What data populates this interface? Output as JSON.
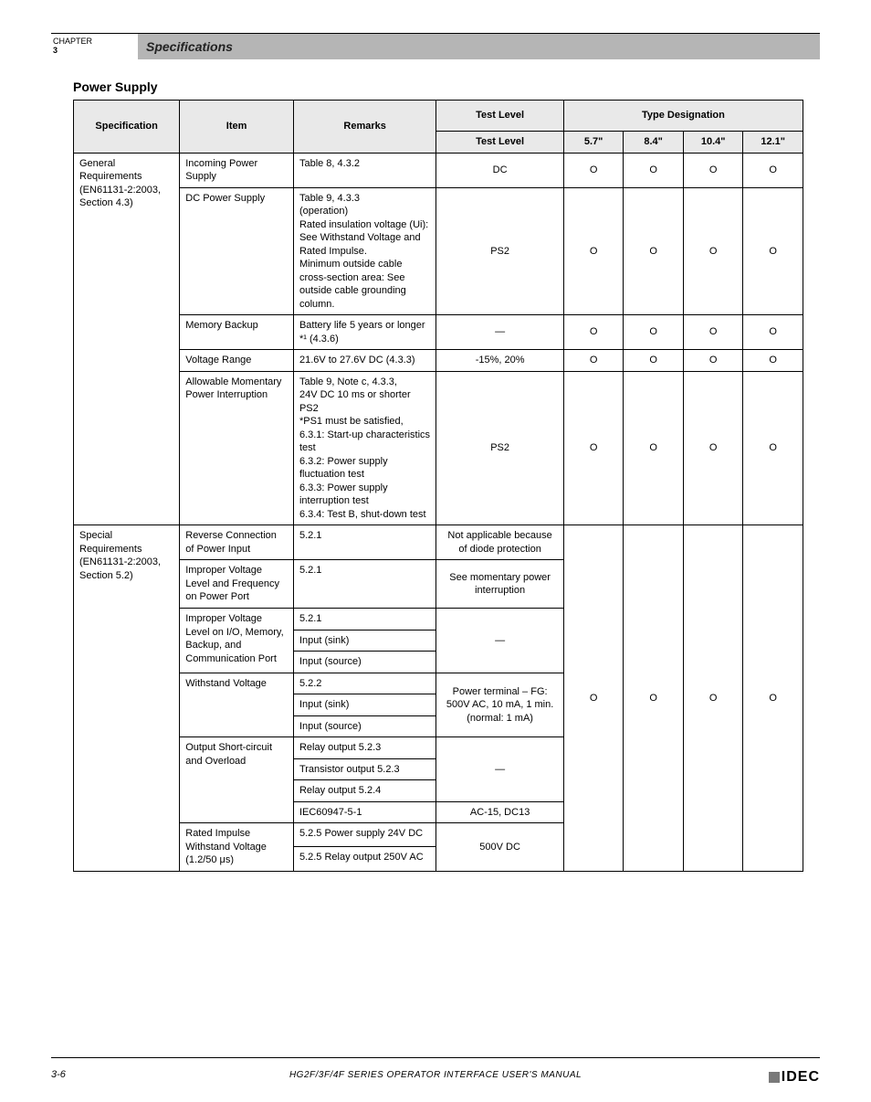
{
  "header": {
    "chapter_line1": "CHAPTER",
    "chapter_line2": "3",
    "title": "Specifications"
  },
  "section_title": "Power Supply",
  "table": {
    "headers": {
      "spec": "Specification",
      "item": "Item",
      "remarks": "Remarks",
      "test_level": "Test Level",
      "type_header": "Type Designation",
      "types": [
        "5.7\"",
        "8.4\"",
        "10.4\"",
        "12.1\""
      ]
    },
    "groups": [
      {
        "spec": "General Requirements\n(EN61131-2:2003,\nSection 4.3)",
        "rows": [
          {
            "item": "Incoming Power Supply",
            "remarks": "Table 8, 4.3.2",
            "test_level": "DC",
            "cells": [
              "O",
              "O",
              "O",
              "O"
            ]
          },
          {
            "item": "DC Power Supply",
            "remarks": "Table 9, 4.3.3\n(operation)\nRated insulation voltage (Ui): See Withstand Voltage and Rated Impulse.\nMinimum outside cable cross-section area: See outside cable grounding column.",
            "test_level": "PS2",
            "cells": [
              "O",
              "O",
              "O",
              "O"
            ]
          },
          {
            "item": "Memory Backup",
            "remarks": "Battery life 5 years or longer *¹ (4.3.6)",
            "test_level": "—",
            "cells": [
              "O",
              "O",
              "O",
              "O"
            ]
          },
          {
            "item": "Voltage Range",
            "remarks": "21.6V to 27.6V DC (4.3.3)",
            "test_level": "-15%, 20%",
            "cells": [
              "O",
              "O",
              "O",
              "O"
            ]
          },
          {
            "item": "Allowable Momentary Power Interruption",
            "remarks": "Table 9, Note c, 4.3.3,\n24V DC 10 ms or shorter PS2\n*PS1 must be satisfied,\n6.3.1: Start-up characteristics test\n6.3.2: Power supply fluctuation test\n6.3.3: Power supply interruption test\n6.3.4: Test B, shut-down test",
            "test_level": "PS2",
            "cells": [
              "O",
              "O",
              "O",
              "O"
            ]
          }
        ]
      },
      {
        "spec": "Special Requirements\n(EN61131-2:2003,\nSection 5.2)",
        "rows": [
          {
            "item": "Reverse Connection of Power Input",
            "remarks": "5.2.1",
            "test_level": "Not applicable because of diode protection",
            "cells": [
              "O",
              "O",
              "O",
              "O"
            ]
          },
          {
            "item": "Improper Voltage Level and Frequency on Power Port",
            "remarks": "5.2.1",
            "test_level": "See momentary power interruption",
            "cells": [
              "",
              "",
              "",
              ""
            ]
          },
          {
            "item": "Improper Voltage Level on I/O, Memory, Backup, and Communication Port",
            "remarks_list": [
              "5.2.1",
              "Input (sink)",
              "Input (source)"
            ],
            "test_level": "—",
            "cells": [
              "",
              "",
              "",
              ""
            ]
          },
          {
            "item": "Withstand Voltage",
            "remarks_list": [
              "5.2.2",
              "Input (sink)",
              "Input (source)"
            ],
            "test_level": "Power terminal – FG: 500V AC, 10 mA, 1 min. (normal: 1 mA)",
            "cells": [
              "",
              "",
              "",
              ""
            ]
          },
          {
            "item": "Output Short-circuit and Overload",
            "remarks_list": [
              "Relay output 5.2.3",
              "Transistor output 5.2.3",
              "Relay output 5.2.4",
              "IEC60947-5-1"
            ],
            "test_level_top": "—",
            "test_level_bottom": "AC-15, DC13",
            "cells": [
              "",
              "",
              "",
              ""
            ]
          },
          {
            "item": "Rated Impulse Withstand Voltage (1.2/50 μs)",
            "remarks_list": [
              "5.2.5 Power supply 24V DC",
              "5.2.5 Relay output 250V AC"
            ],
            "test_level": "500V DC",
            "cells": [
              "",
              "",
              "",
              ""
            ]
          }
        ]
      }
    ]
  },
  "footer": {
    "page_number": "3-6",
    "center_text": "HG2F/3F/4F SERIES OPERATOR INTERFACE USER'S MANUAL",
    "logo_text": "IDEC"
  }
}
